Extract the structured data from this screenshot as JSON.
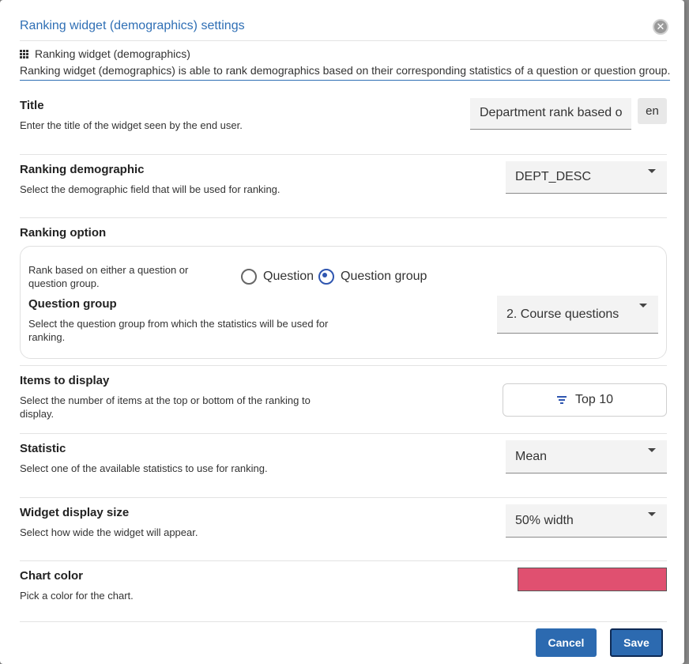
{
  "dialog": {
    "title": "Ranking widget (demographics) settings",
    "close_symbol": "✕"
  },
  "widget": {
    "name": "Ranking widget (demographics)",
    "description": "Ranking widget (demographics) is able to rank demographics based on their corresponding statistics of a question or question group."
  },
  "title_section": {
    "label": "Title",
    "desc": "Enter the title of the widget seen by the end user.",
    "value": "Department rank based o",
    "lang": "en"
  },
  "ranking_demographic": {
    "label": "Ranking demographic",
    "desc": "Select the demographic field that will be used for ranking.",
    "value": "DEPT_DESC"
  },
  "ranking_option": {
    "label": "Ranking option",
    "desc": "Rank based on either a question or question group.",
    "radio_question": "Question",
    "radio_group": "Question group",
    "selected": "Question group",
    "qg_label": "Question group",
    "qg_desc": "Select the question group from which the statistics will be used for ranking.",
    "qg_value": "2. Course questions"
  },
  "items_to_display": {
    "label": "Items to display",
    "desc": "Select the number of items at the top or bottom of the ranking to display.",
    "value": "Top 10"
  },
  "statistic": {
    "label": "Statistic",
    "desc": "Select one of the available statistics to use for ranking.",
    "value": "Mean"
  },
  "display_size": {
    "label": "Widget display size",
    "desc": "Select how wide the widget will appear.",
    "value": "50% width"
  },
  "chart_color": {
    "label": "Chart color",
    "desc": "Pick a color for the chart.",
    "color": "#e05070"
  },
  "buttons": {
    "cancel": "Cancel",
    "save": "Save"
  },
  "colors": {
    "accent": "#2c6ab0",
    "title_blue": "#2f6fb5"
  }
}
